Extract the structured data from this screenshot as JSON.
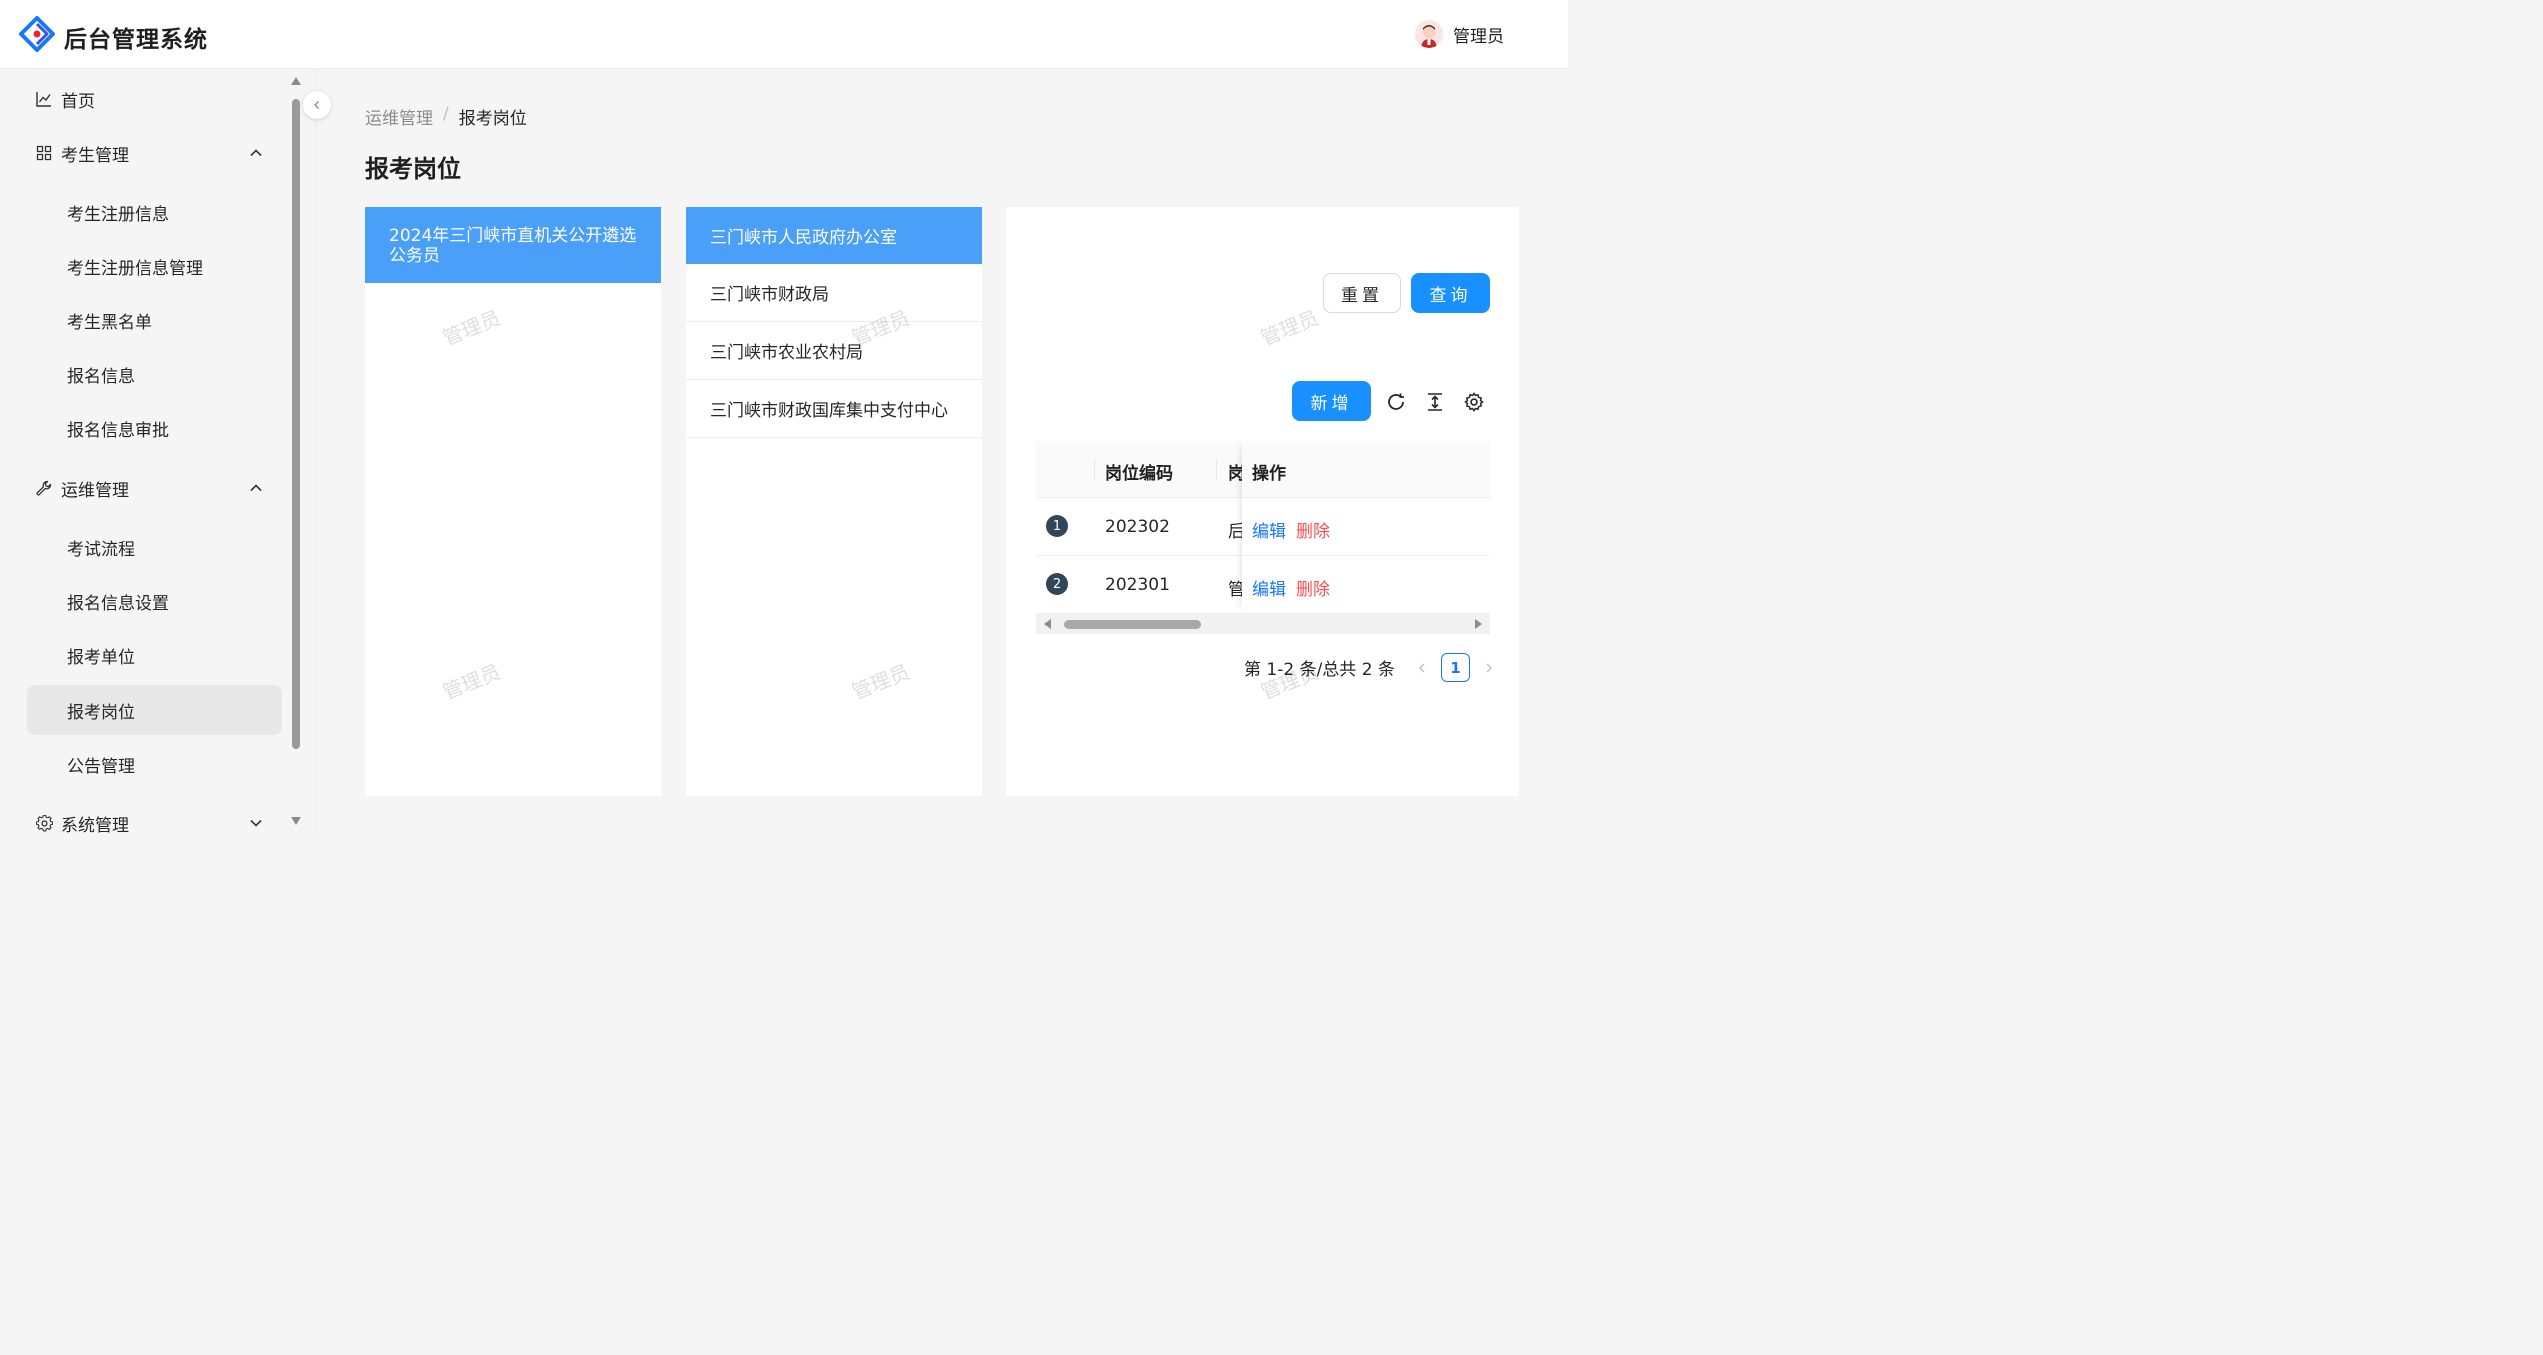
{
  "header": {
    "app_title": "后台管理系统",
    "user_name": "管理员"
  },
  "sidebar": {
    "items": [
      {
        "label": "首页",
        "icon": "line-chart-icon",
        "level": 1
      },
      {
        "label": "考生管理",
        "icon": "grid-icon",
        "level": 1,
        "expanded": true
      },
      {
        "label": "考生注册信息",
        "level": 2
      },
      {
        "label": "考生注册信息管理",
        "level": 2
      },
      {
        "label": "考生黑名单",
        "level": 2
      },
      {
        "label": "报名信息",
        "level": 2
      },
      {
        "label": "报名信息审批",
        "level": 2
      },
      {
        "label": "运维管理",
        "icon": "wrench-icon",
        "level": 1,
        "expanded": true
      },
      {
        "label": "考试流程",
        "level": 2
      },
      {
        "label": "报名信息设置",
        "level": 2
      },
      {
        "label": "报考单位",
        "level": 2
      },
      {
        "label": "报考岗位",
        "level": 2,
        "active": true
      },
      {
        "label": "公告管理",
        "level": 2
      },
      {
        "label": "系统管理",
        "icon": "gear-icon",
        "level": 1,
        "expanded": false
      }
    ]
  },
  "breadcrumb": {
    "parent": "运维管理",
    "separator": "/",
    "current": "报考岗位"
  },
  "page_title": "报考岗位",
  "exam_panel": {
    "items": [
      "2024年三门峡市直机关公开遴选公务员"
    ],
    "selected_index": 0
  },
  "unit_panel": {
    "items": [
      "三门峡市人民政府办公室",
      "三门峡市财政局",
      "三门峡市农业农村局",
      "三门峡市财政国库集中支付中心"
    ],
    "selected_index": 0
  },
  "search": {
    "reset_label": "重置",
    "query_label": "查询"
  },
  "toolbar": {
    "add_label": "新增"
  },
  "table": {
    "columns": [
      "岗位编码",
      "岗",
      "操作"
    ],
    "rows": [
      {
        "index": "1",
        "code": "202302",
        "name_fragment": "后",
        "edit": "编辑",
        "delete": "删除"
      },
      {
        "index": "2",
        "code": "202301",
        "name_fragment": "管",
        "edit": "编辑",
        "delete": "删除"
      }
    ]
  },
  "pagination": {
    "total_text": "第 1-2 条/总共 2 条",
    "current_page": "1"
  },
  "watermark_text": "管理员",
  "colors": {
    "primary": "#1890ff",
    "selected_bg": "#4a9ff9",
    "danger": "#ff4d4f",
    "link": "#1677ff"
  }
}
